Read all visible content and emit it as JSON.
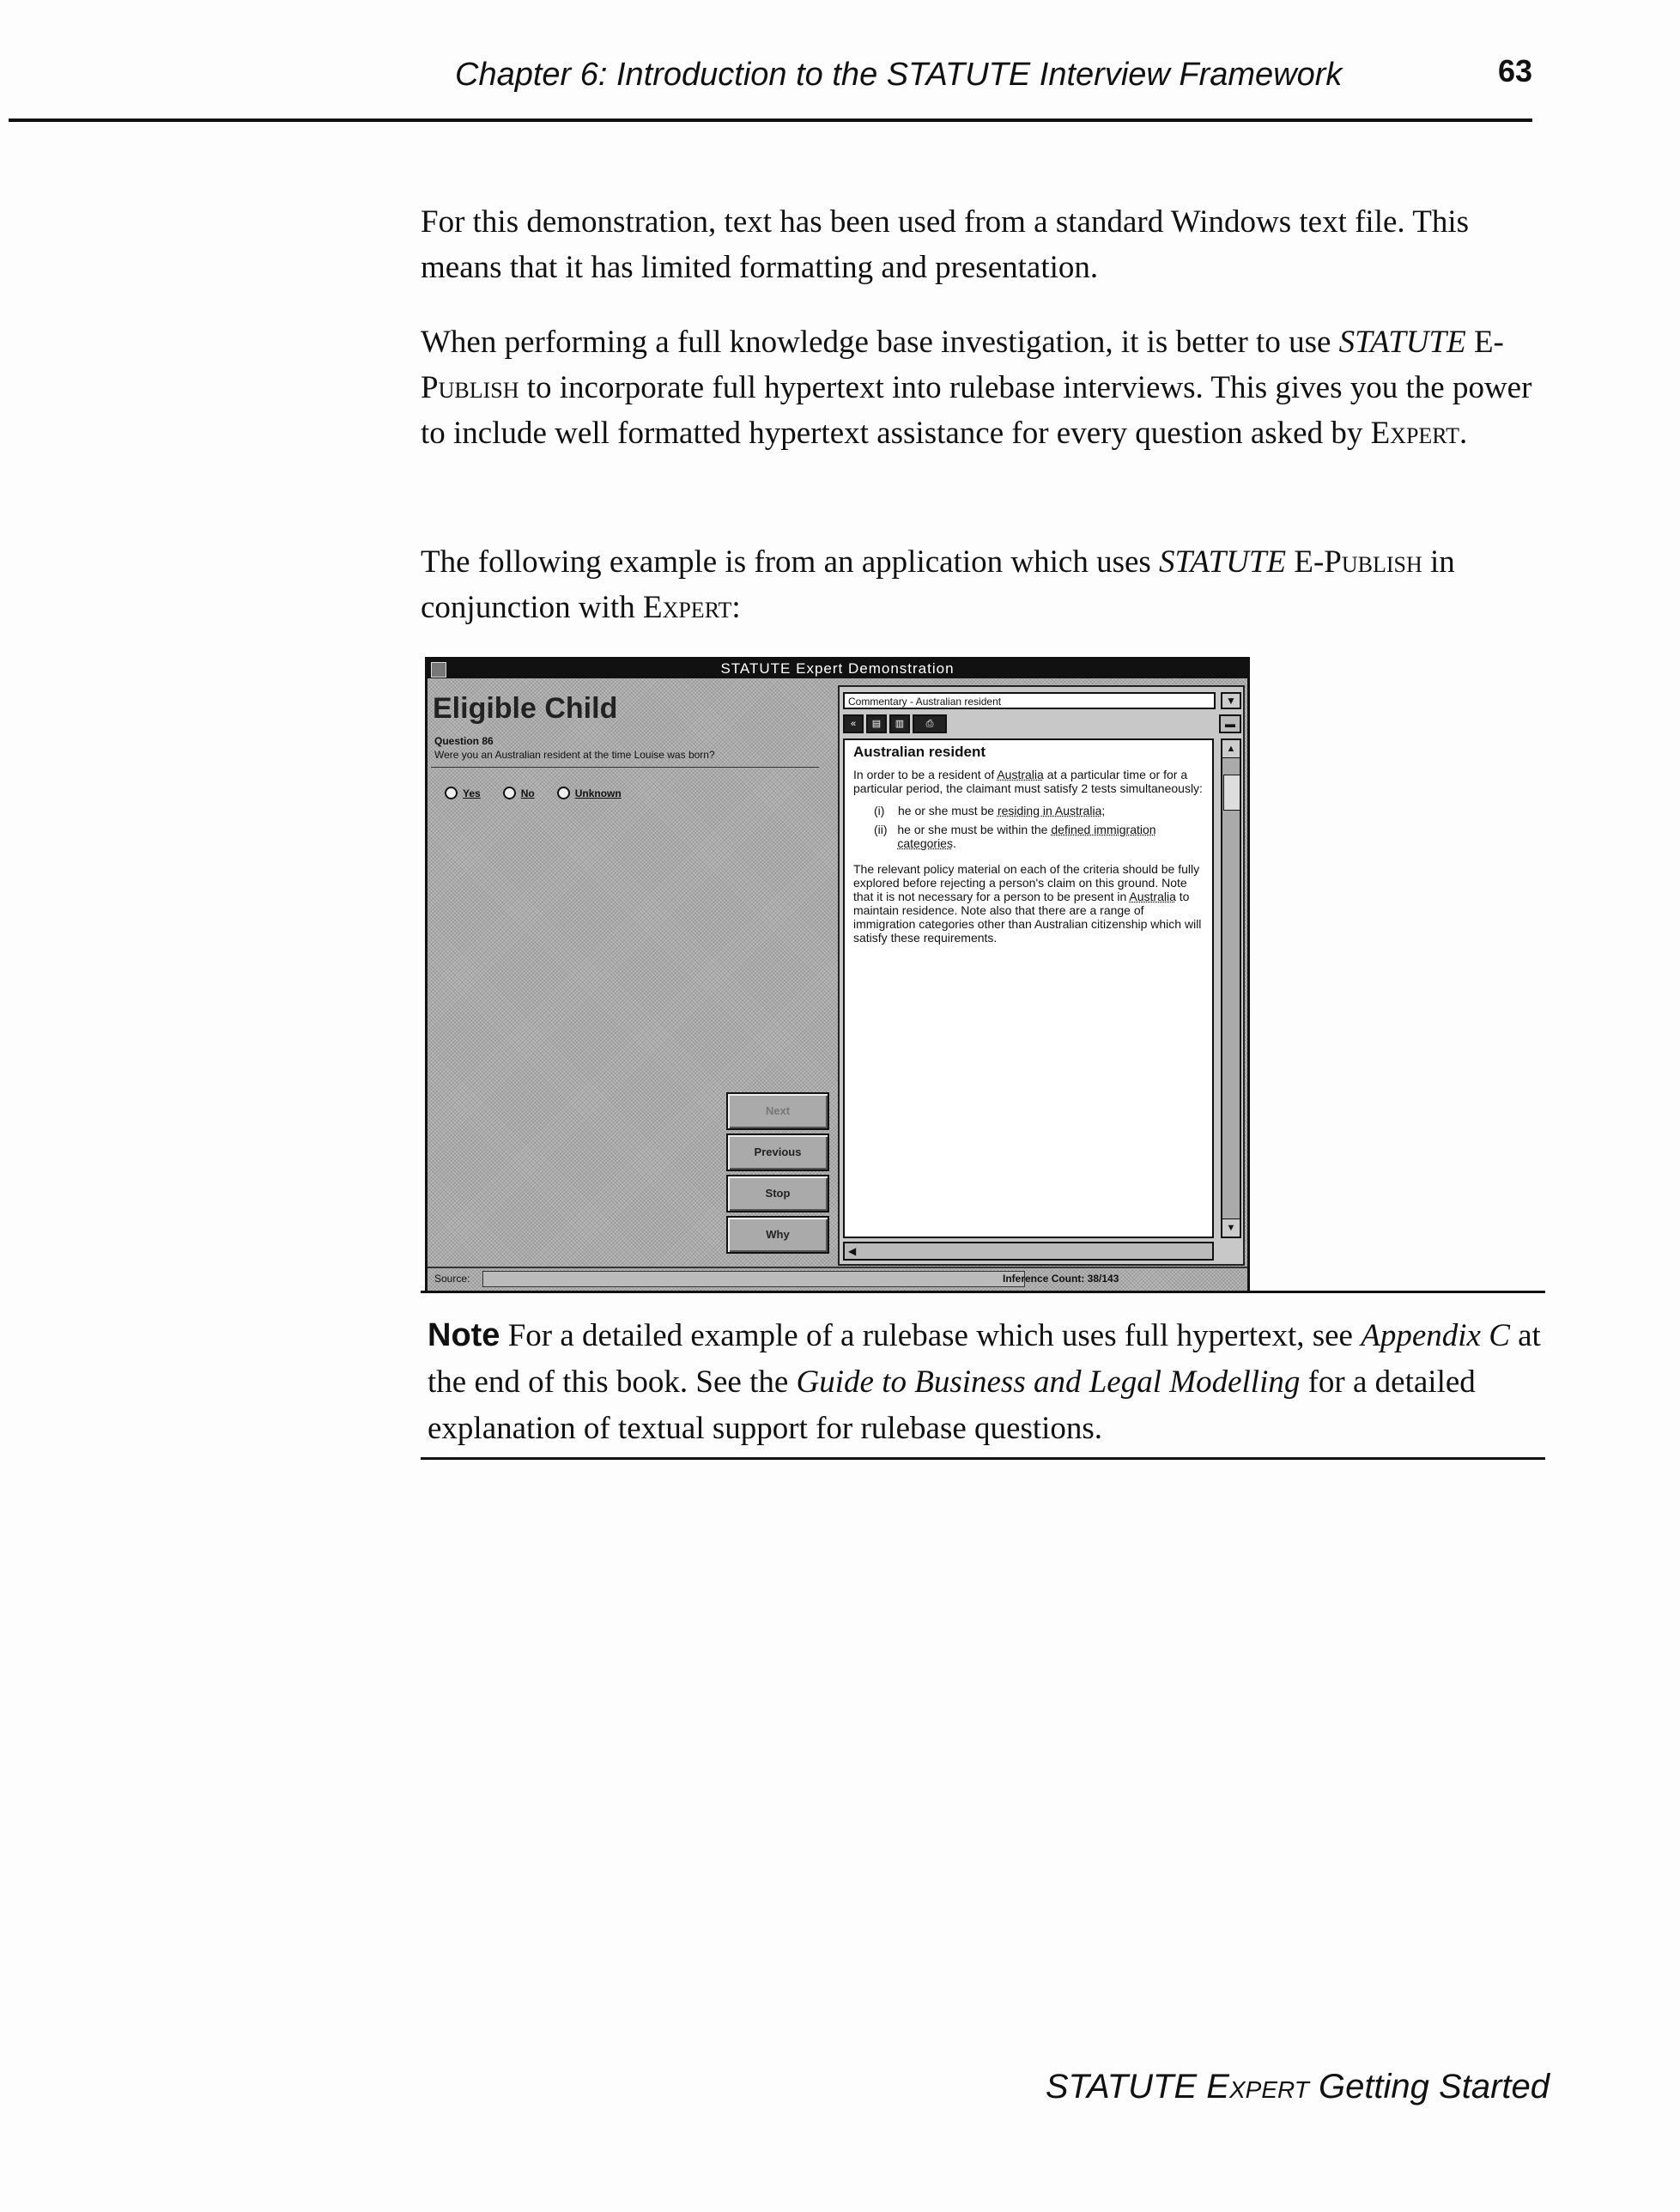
{
  "header": {
    "chapter_title": "Chapter 6: Introduction to the STATUTE Interview Framework",
    "page_number": "63"
  },
  "body": {
    "p1": "For this demonstration, text has been used from a standard Windows text file. This means that it has limited formatting and presentation.",
    "p2_a": "When performing a full knowledge base investigation, it is better to use",
    "p2_statute": "STATUTE",
    "p2_epublish": "E-Publish",
    "p2_b": "to incorporate full hypertext into rulebase interviews. This gives you the power to include well formatted hypertext assistance for every question asked by",
    "p2_expert": "Expert",
    "p2_end": ".",
    "p3_a": "The following example is from an application which uses",
    "p3_statute": "STATUTE",
    "p3_epublish": "E-Publish",
    "p3_b": "in conjunction with",
    "p3_expert": "Expert",
    "p3_end": ":"
  },
  "screenshot": {
    "window_title": "STATUTE Expert Demonstration",
    "question_heading": "Eligible Child",
    "question_number": "Question 86",
    "question_text": "Were you an Australian resident at the time Louise was born?",
    "answers": {
      "yes": "Yes",
      "no": "No",
      "unknown": "Unknown"
    },
    "buttons": {
      "next": "Next",
      "previous": "Previous",
      "stop": "Stop",
      "why": "Why"
    },
    "status_source": "Source:",
    "inference_count": "Inference Count: 38/143",
    "commentary_combo": "Commentary - Australian resident",
    "doc_title": "Australian resident",
    "doc_intro_a": "In order to be a resident of",
    "doc_intro_link": "Australia",
    "doc_intro_b": "at a particular time or for a particular period, the claimant must satisfy 2 tests simultaneously:",
    "item1_num": "(i)",
    "item1_a": "he or she must be",
    "item1_link": "residing in Australia",
    "item1_end": ";",
    "item2_num": "(ii)",
    "item2_a": "he or she must be within the",
    "item2_link": "defined immigration categories",
    "item2_end": ".",
    "doc_body_a": "The relevant policy material on each of the criteria should be fully explored before rejecting a person's claim on this ground. Note that it is not necessary for a person to be present in",
    "doc_body_link": "Australia",
    "doc_body_b": "to maintain residence. Note also that there are a range of immigration categories other than Australian citizenship which will satisfy these requirements."
  },
  "note": {
    "label": "Note",
    "text_a": "For a detailed example of a rulebase which uses full hypertext, see",
    "appendix": "Appendix C",
    "text_b": "at the end of this book. See the",
    "guide": "Guide to Business and Legal Modelling",
    "text_c": "for a detailed explanation of textual support for rulebase questions."
  },
  "footer": {
    "statute": "STATUTE",
    "expert": "Expert",
    "rest": "Getting Started"
  }
}
